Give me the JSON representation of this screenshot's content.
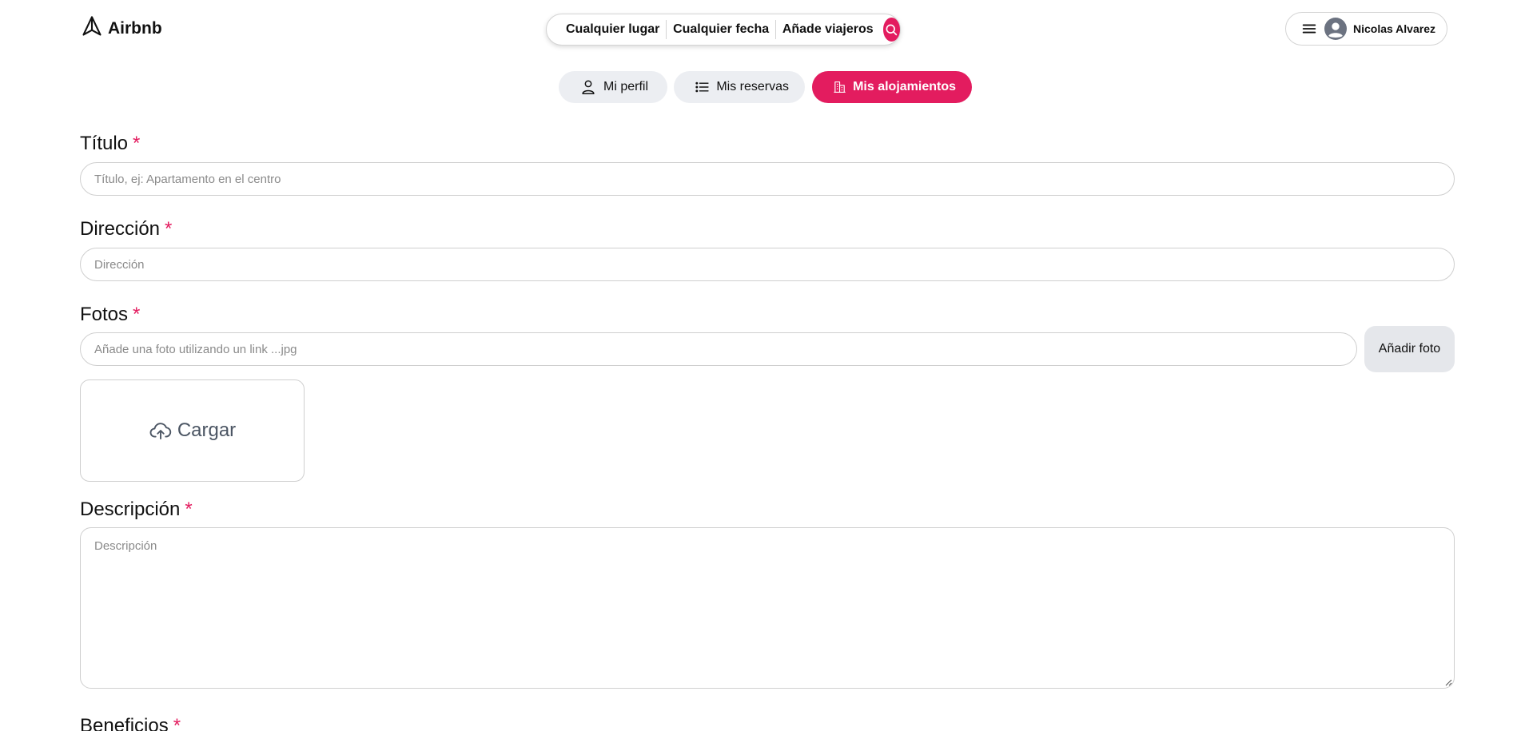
{
  "header": {
    "logo_text": "Airbnb",
    "search": {
      "place": "Cualquier lugar",
      "date": "Cualquier fecha",
      "guests": "Añade viajeros"
    },
    "user_name": "Nicolas Alvarez"
  },
  "tabs": [
    {
      "label": "Mi perfil",
      "icon": "user-icon",
      "active": false
    },
    {
      "label": "Mis reservas",
      "icon": "list-icon",
      "active": false
    },
    {
      "label": "Mis alojamientos",
      "icon": "buildings-icon",
      "active": true
    }
  ],
  "form": {
    "title": {
      "label": "Título",
      "required_mark": "*",
      "placeholder": "Título, ej: Apartamento en el centro"
    },
    "address": {
      "label": "Dirección",
      "required_mark": "*",
      "placeholder": "Dirección"
    },
    "photos": {
      "label": "Fotos",
      "required_mark": "*",
      "placeholder": "Añade una foto utilizando un link ...jpg",
      "add_button": "Añadir foto",
      "upload_label": "Cargar"
    },
    "description": {
      "label": "Descripción",
      "required_mark": "*",
      "placeholder": "Descripción"
    },
    "benefits": {
      "label": "Beneficios",
      "required_mark": "*"
    }
  },
  "colors": {
    "accent": "#e31c5f",
    "tab_bg": "#eceef2",
    "border": "#cfcfcf"
  }
}
